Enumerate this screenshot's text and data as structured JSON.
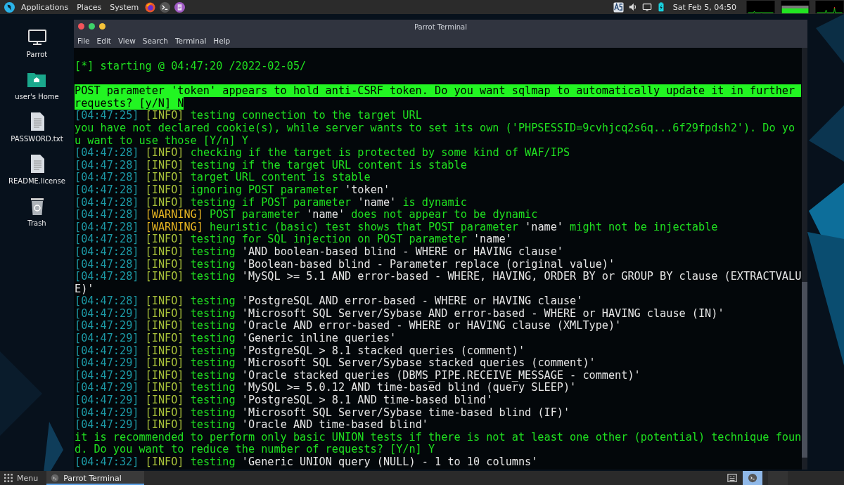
{
  "top_panel": {
    "menus": [
      "Applications",
      "Places",
      "System"
    ],
    "clock": "Sat Feb 5, 04:50"
  },
  "desktop_icons": [
    {
      "label": "Parrot",
      "kind": "monitor"
    },
    {
      "label": "user's Home",
      "kind": "folder"
    },
    {
      "label": "PASSWORD.txt",
      "kind": "file"
    },
    {
      "label": "README.license",
      "kind": "file"
    },
    {
      "label": "Trash",
      "kind": "trash"
    }
  ],
  "window": {
    "title": "Parrot Terminal",
    "menu": [
      "File",
      "Edit",
      "View",
      "Search",
      "Terminal",
      "Help"
    ]
  },
  "terminal_lines": [
    {
      "kind": "plain",
      "text": "[*] starting @ 04:47:20 /2022-02-05/"
    },
    {
      "kind": "blank"
    },
    {
      "kind": "highlight",
      "text": "POST parameter 'token' appears to hold anti-CSRF token. Do you want sqlmap to automatically update it in further requests? [y/N] N"
    },
    {
      "kind": "log",
      "time": "[04:47:25]",
      "level": {
        "text": "[INFO]",
        "kind": "info"
      },
      "message": [
        {
          "text": "testing connection to the target URL",
          "quoted": false
        }
      ]
    },
    {
      "kind": "plain",
      "text": "you have not declared cookie(s), while server wants to set its own ('PHPSESSID=9cvhjcq2s6q...6f29fpdsh2'). Do you want to use those [Y/n] Y"
    },
    {
      "kind": "log",
      "time": "[04:47:28]",
      "level": {
        "text": "[INFO]",
        "kind": "info"
      },
      "message": [
        {
          "text": "checking if the target is protected by some kind of WAF/IPS",
          "quoted": false
        }
      ]
    },
    {
      "kind": "log",
      "time": "[04:47:28]",
      "level": {
        "text": "[INFO]",
        "kind": "info"
      },
      "message": [
        {
          "text": "testing if the target URL content is stable",
          "quoted": false
        }
      ]
    },
    {
      "kind": "log",
      "time": "[04:47:28]",
      "level": {
        "text": "[INFO]",
        "kind": "info"
      },
      "message": [
        {
          "text": "target URL content is stable",
          "quoted": false
        }
      ]
    },
    {
      "kind": "log",
      "time": "[04:47:28]",
      "level": {
        "text": "[INFO]",
        "kind": "info"
      },
      "message": [
        {
          "text": "ignoring POST parameter ",
          "quoted": false
        },
        {
          "text": "'token'",
          "quoted": true
        }
      ]
    },
    {
      "kind": "log",
      "time": "[04:47:28]",
      "level": {
        "text": "[INFO]",
        "kind": "info"
      },
      "message": [
        {
          "text": "testing if POST parameter ",
          "quoted": false
        },
        {
          "text": "'name'",
          "quoted": true
        },
        {
          "text": " is dynamic",
          "quoted": false
        }
      ]
    },
    {
      "kind": "log",
      "time": "[04:47:28]",
      "level": {
        "text": "[WARNING]",
        "kind": "warning"
      },
      "message": [
        {
          "text": "POST parameter ",
          "quoted": false
        },
        {
          "text": "'name'",
          "quoted": true
        },
        {
          "text": " does not appear to be dynamic",
          "quoted": false
        }
      ]
    },
    {
      "kind": "log",
      "time": "[04:47:28]",
      "level": {
        "text": "[WARNING]",
        "kind": "warning"
      },
      "message": [
        {
          "text": "heuristic (basic) test shows that POST parameter ",
          "quoted": false
        },
        {
          "text": "'name'",
          "quoted": true
        },
        {
          "text": " might not be injectable",
          "quoted": false
        }
      ]
    },
    {
      "kind": "log",
      "time": "[04:47:28]",
      "level": {
        "text": "[INFO]",
        "kind": "info"
      },
      "message": [
        {
          "text": "testing for SQL injection on POST parameter ",
          "quoted": false
        },
        {
          "text": "'name'",
          "quoted": true
        }
      ]
    },
    {
      "kind": "log",
      "time": "[04:47:28]",
      "level": {
        "text": "[INFO]",
        "kind": "info"
      },
      "message": [
        {
          "text": "testing ",
          "quoted": false
        },
        {
          "text": "'AND boolean-based blind - WHERE or HAVING clause'",
          "quoted": true
        }
      ]
    },
    {
      "kind": "log",
      "time": "[04:47:28]",
      "level": {
        "text": "[INFO]",
        "kind": "info"
      },
      "message": [
        {
          "text": "testing ",
          "quoted": false
        },
        {
          "text": "'Boolean-based blind - Parameter replace (original value)'",
          "quoted": true
        }
      ]
    },
    {
      "kind": "log",
      "time": "[04:47:28]",
      "level": {
        "text": "[INFO]",
        "kind": "info"
      },
      "message": [
        {
          "text": "testing ",
          "quoted": false
        },
        {
          "text": "'MySQL >= 5.1 AND error-based - WHERE, HAVING, ORDER BY or GROUP BY clause (EXTRACTVALUE)'",
          "quoted": true
        }
      ]
    },
    {
      "kind": "log",
      "time": "[04:47:28]",
      "level": {
        "text": "[INFO]",
        "kind": "info"
      },
      "message": [
        {
          "text": "testing ",
          "quoted": false
        },
        {
          "text": "'PostgreSQL AND error-based - WHERE or HAVING clause'",
          "quoted": true
        }
      ]
    },
    {
      "kind": "log",
      "time": "[04:47:29]",
      "level": {
        "text": "[INFO]",
        "kind": "info"
      },
      "message": [
        {
          "text": "testing ",
          "quoted": false
        },
        {
          "text": "'Microsoft SQL Server/Sybase AND error-based - WHERE or HAVING clause (IN)'",
          "quoted": true
        }
      ]
    },
    {
      "kind": "log",
      "time": "[04:47:29]",
      "level": {
        "text": "[INFO]",
        "kind": "info"
      },
      "message": [
        {
          "text": "testing ",
          "quoted": false
        },
        {
          "text": "'Oracle AND error-based - WHERE or HAVING clause (XMLType)'",
          "quoted": true
        }
      ]
    },
    {
      "kind": "log",
      "time": "[04:47:29]",
      "level": {
        "text": "[INFO]",
        "kind": "info"
      },
      "message": [
        {
          "text": "testing ",
          "quoted": false
        },
        {
          "text": "'Generic inline queries'",
          "quoted": true
        }
      ]
    },
    {
      "kind": "log",
      "time": "[04:47:29]",
      "level": {
        "text": "[INFO]",
        "kind": "info"
      },
      "message": [
        {
          "text": "testing ",
          "quoted": false
        },
        {
          "text": "'PostgreSQL > 8.1 stacked queries (comment)'",
          "quoted": true
        }
      ]
    },
    {
      "kind": "log",
      "time": "[04:47:29]",
      "level": {
        "text": "[INFO]",
        "kind": "info"
      },
      "message": [
        {
          "text": "testing ",
          "quoted": false
        },
        {
          "text": "'Microsoft SQL Server/Sybase stacked queries (comment)'",
          "quoted": true
        }
      ]
    },
    {
      "kind": "log",
      "time": "[04:47:29]",
      "level": {
        "text": "[INFO]",
        "kind": "info"
      },
      "message": [
        {
          "text": "testing ",
          "quoted": false
        },
        {
          "text": "'Oracle stacked queries (DBMS_PIPE.RECEIVE_MESSAGE - comment)'",
          "quoted": true
        }
      ]
    },
    {
      "kind": "log",
      "time": "[04:47:29]",
      "level": {
        "text": "[INFO]",
        "kind": "info"
      },
      "message": [
        {
          "text": "testing ",
          "quoted": false
        },
        {
          "text": "'MySQL >= 5.0.12 AND time-based blind (query SLEEP)'",
          "quoted": true
        }
      ]
    },
    {
      "kind": "log",
      "time": "[04:47:29]",
      "level": {
        "text": "[INFO]",
        "kind": "info"
      },
      "message": [
        {
          "text": "testing ",
          "quoted": false
        },
        {
          "text": "'PostgreSQL > 8.1 AND time-based blind'",
          "quoted": true
        }
      ]
    },
    {
      "kind": "log",
      "time": "[04:47:29]",
      "level": {
        "text": "[INFO]",
        "kind": "info"
      },
      "message": [
        {
          "text": "testing ",
          "quoted": false
        },
        {
          "text": "'Microsoft SQL Server/Sybase time-based blind (IF)'",
          "quoted": true
        }
      ]
    },
    {
      "kind": "log",
      "time": "[04:47:29]",
      "level": {
        "text": "[INFO]",
        "kind": "info"
      },
      "message": [
        {
          "text": "testing ",
          "quoted": false
        },
        {
          "text": "'Oracle AND time-based blind'",
          "quoted": true
        }
      ]
    },
    {
      "kind": "plain",
      "text": "it is recommended to perform only basic UNION tests if there is not at least one other (potential) technique found. Do you want to reduce the number of requests? [Y/n] Y"
    },
    {
      "kind": "log",
      "time": "[04:47:32]",
      "level": {
        "text": "[INFO]",
        "kind": "info"
      },
      "message": [
        {
          "text": "testing ",
          "quoted": false
        },
        {
          "text": "'Generic UNION query (NULL) - 1 to 10 columns'",
          "quoted": true
        }
      ]
    }
  ],
  "taskbar": {
    "menu_label": "Menu",
    "tasks": [
      {
        "label": "Parrot Terminal",
        "selected": true
      }
    ],
    "workspaces": [
      {
        "selected": true
      },
      {
        "selected": false
      }
    ]
  }
}
